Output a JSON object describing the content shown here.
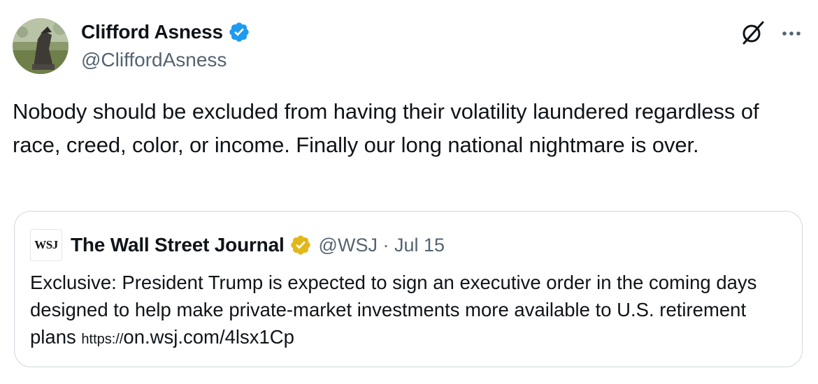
{
  "tweet": {
    "author": {
      "name": "Clifford Asness",
      "handle": "@CliffordAsness",
      "verified": true,
      "badge_color": "#1d9bf0"
    },
    "text": "Nobody should be excluded from having their volatility laundered regardless of race, creed, color, or income. Finally our long national nightmare is over.",
    "icons": [
      "grok-icon",
      "more-icon"
    ]
  },
  "quoted": {
    "logo_text": "WSJ",
    "name": "The Wall Street Journal",
    "handle": "@WSJ",
    "separator": "·",
    "date": "Jul 15",
    "verified": true,
    "badge_color": "#e2b719",
    "text": "Exclusive: President Trump is expected to sign an executive order in the coming days designed to help make private-market investments more available to U.S. retirement plans ",
    "link_prefix": "https://",
    "link": "on.wsj.com/4lsx1Cp"
  },
  "colors": {
    "text": "#0f1419",
    "secondary": "#536471",
    "border": "#cfd9de"
  }
}
